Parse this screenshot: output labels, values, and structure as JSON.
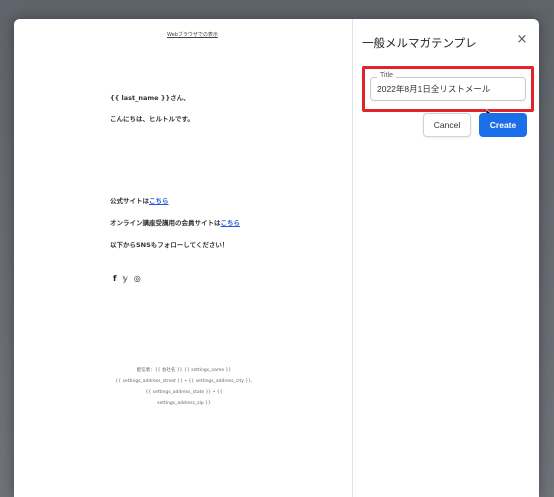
{
  "preview": {
    "webview_link": "Webブラウザでの表示",
    "greeting_name": "{{ last_name }}さん、",
    "greeting_hello": "こんにちは、ヒルトルです。",
    "official_site_prefix": "公式サイトは",
    "official_site_link": "こちら",
    "online_course_prefix": "オンライン講座受講用の会員サイトは",
    "online_course_link": "こちら",
    "follow_text": "以下からSNSもフォローしてください！",
    "social_icons": [
      "facebook-icon",
      "twitter-icon",
      "instagram-icon"
    ],
    "social_glyphs": [
      "f",
      "𝕪",
      "◎"
    ],
    "footer_line1": "配信者：{{ 会社名 }} {{ settings_name }}",
    "footer_line2": "{{ settings_address_street }} • {{ settings_address_city }}, {{ settings_address_state }} • {{",
    "footer_line3": "settings_address_zip }}"
  },
  "panel": {
    "title": "一般メルマガテンプレ",
    "close_glyph": "×",
    "field_label": "Title",
    "field_value": "2022年8月1日全リストメール",
    "cancel_label": "Cancel",
    "create_label": "Create"
  },
  "colors": {
    "primary": "#1a6fe8",
    "highlight": "#e0242c"
  }
}
